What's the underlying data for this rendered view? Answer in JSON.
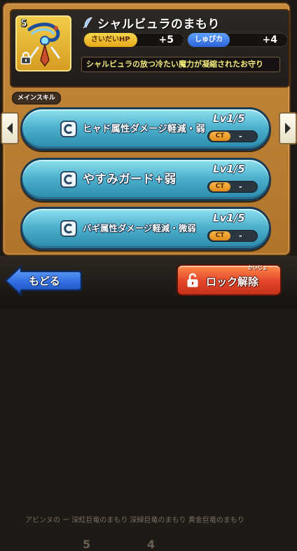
{
  "background": {
    "text": "アビンヌの ー  深紅巨竜のまもり  深緑巨竜のまもり  黄金巨竜のまもり",
    "numbers": [
      "5",
      "4"
    ]
  },
  "item": {
    "rank": "5",
    "name": "シャルビュラのまもり",
    "icon": "feather-icon",
    "stats": [
      {
        "label": "さいだいHP",
        "value": "+5",
        "color": "#f0c23a"
      },
      {
        "label": "しゅびカ",
        "value": "+4",
        "color": "#3a78ee"
      }
    ],
    "description": "シャルビュラの放つ冷たい魔力が凝縮されたお守り"
  },
  "skills_section": {
    "label": "メインスキル",
    "left_arrow_icon": "chevron-left-icon",
    "right_arrow_icon": "chevron-right-icon"
  },
  "skills": [
    {
      "icon": "c-badge-icon",
      "name": "ヒャド属性ダメージ軽減・弱",
      "level": "Lv1/5",
      "ct_label": "CT",
      "ct_value": "-"
    },
    {
      "icon": "c-badge-icon",
      "name": "やすみガード+弱",
      "level": "Lv1/5",
      "ct_label": "CT",
      "ct_value": "-"
    },
    {
      "icon": "c-badge-icon",
      "name": "バギ属性ダメージ軽減・微弱",
      "level": "Lv1/5",
      "ct_label": "CT",
      "ct_value": "-"
    }
  ],
  "footer": {
    "back_label": "もどる",
    "unlock_label": "ロック解除",
    "unlock_ruby": "かいじょ"
  },
  "colors": {
    "frame": "#c68a3c",
    "skill_button": "#4fb2cd",
    "description_text": "#f2ea7a",
    "unlock_button": "#e2452a",
    "back_button": "#2f6ce0"
  }
}
